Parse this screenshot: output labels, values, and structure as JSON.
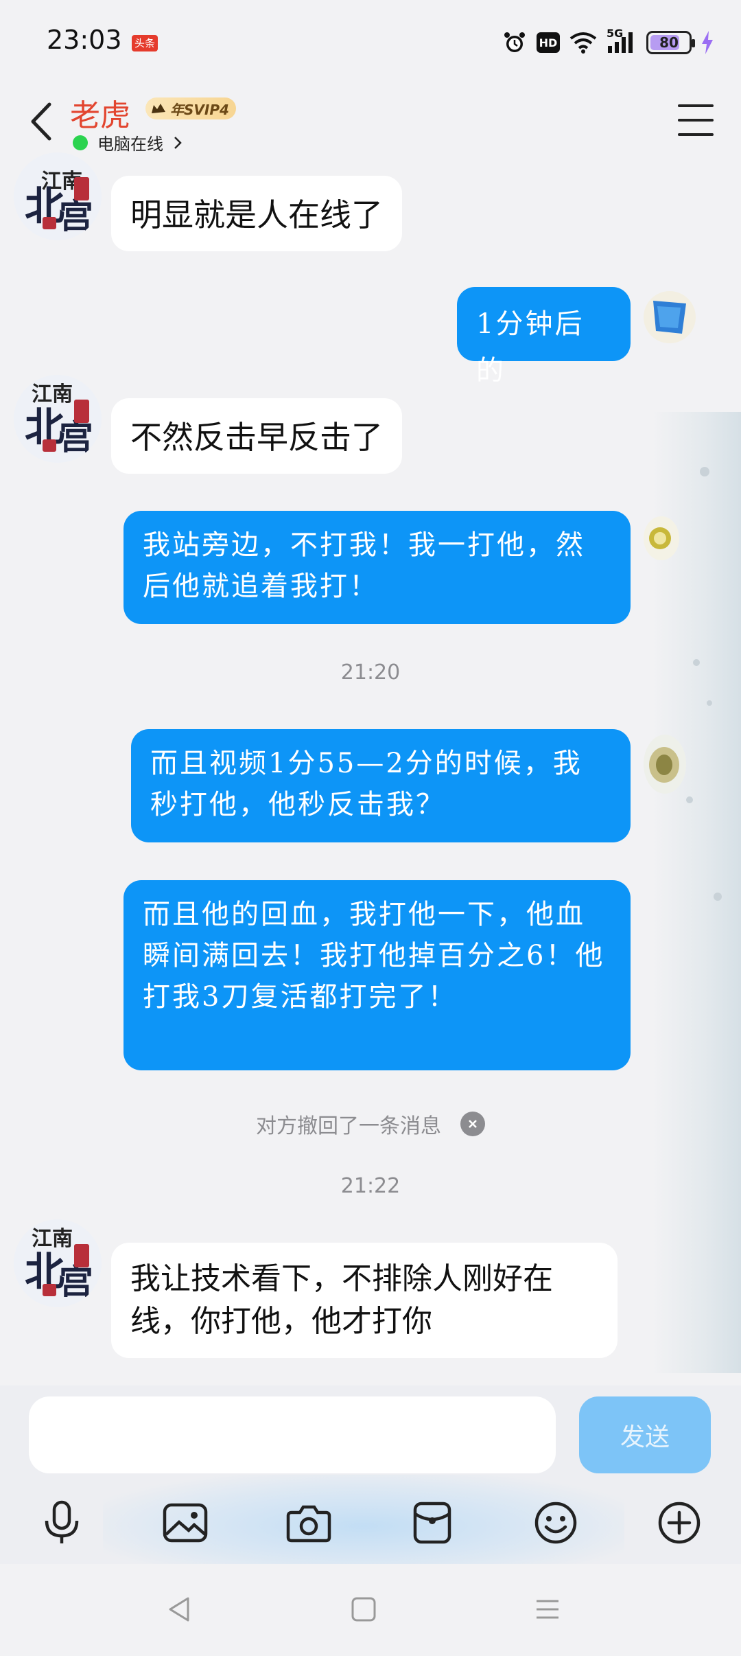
{
  "status_bar": {
    "time": "23:03",
    "news_badge": "头条",
    "hd_label": "HD",
    "network_label": "5G",
    "battery_level": 80,
    "battery_text": "80"
  },
  "header": {
    "contact_name": "老虎",
    "vip_label": "年SVIP4",
    "online_status": "电脑在线",
    "online_color": "#2bd34f",
    "name_color": "#e2452f"
  },
  "messages": [
    {
      "direction": "in",
      "text": "明显就是人在线了"
    },
    {
      "direction": "out",
      "text": "1分钟后的"
    },
    {
      "direction": "in",
      "text": "不然反击早反击了"
    },
    {
      "direction": "out",
      "text": "我站旁边，不打我！我一打他，然后他就追着我打！"
    },
    {
      "type": "timestamp",
      "text": "21:20"
    },
    {
      "direction": "out",
      "text": "而且视频1分55—2分的时候，我秒打他，他秒反击我？"
    },
    {
      "direction": "out",
      "text": "而且他的回血，我打他一下，他血瞬间满回去！我打他掉百分之6！他打我3刀复活都打完了！"
    },
    {
      "type": "recall",
      "text": "对方撤回了一条消息"
    },
    {
      "type": "timestamp",
      "text": "21:22"
    },
    {
      "direction": "in",
      "text": "我让技术看下，不排除人刚好在线，你打他，他才打你"
    }
  ],
  "input": {
    "placeholder": "",
    "value": "",
    "send_label": "发送"
  },
  "toolbar_icons": [
    "microphone-icon",
    "image-icon",
    "camera-icon",
    "red-packet-icon",
    "emoji-icon",
    "plus-icon"
  ],
  "nav_icons": [
    "back-triangle-icon",
    "home-square-icon",
    "recents-menu-icon"
  ],
  "colors": {
    "bubble_out": "#0d95f7",
    "bubble_in": "#ffffff",
    "send_button": "#7dc4f7",
    "background": "#f2f2f4"
  }
}
